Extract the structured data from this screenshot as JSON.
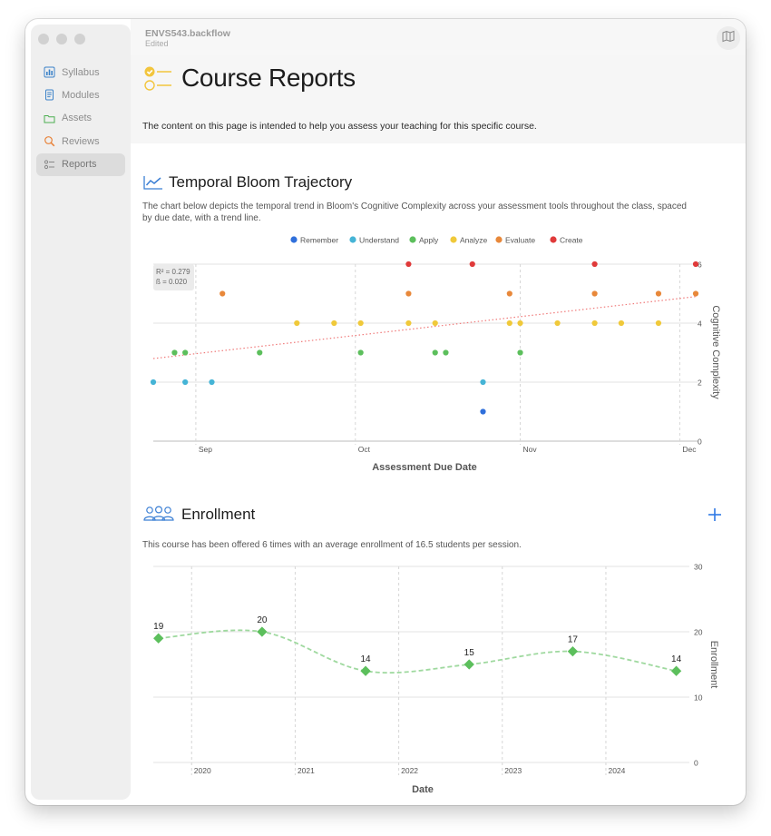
{
  "document": {
    "title": "ENVS543.backflow",
    "subtitle": "Edited"
  },
  "sidebar": {
    "items": [
      {
        "label": "Syllabus",
        "icon": "chart-bar-icon",
        "color": "#3b82c8"
      },
      {
        "label": "Modules",
        "icon": "document-icon",
        "color": "#3b82c8"
      },
      {
        "label": "Assets",
        "icon": "folder-icon",
        "color": "#4caf50"
      },
      {
        "label": "Reviews",
        "icon": "magnifier-icon",
        "color": "#e8833a"
      },
      {
        "label": "Reports",
        "icon": "checklist-icon",
        "color": "#888888"
      }
    ],
    "active_index": 4
  },
  "header": {
    "title": "Course Reports",
    "description": "The content on this page is intended to help you assess your teaching for this specific course."
  },
  "bloom": {
    "title": "Temporal Bloom Trajectory",
    "description_line1": "The chart below depicts the temporal trend in Bloom's Cognitive Complexity across your assessment tools throughout the class, spaced",
    "description_line2": "by due date, with a trend line."
  },
  "enrollment": {
    "title": "Enrollment",
    "description": "This course has been offered 6 times with an average enrollment of 16.5 students per session."
  },
  "chart_data": [
    {
      "type": "scatter",
      "legend": [
        {
          "name": "Remember",
          "color": "#2f6fdb"
        },
        {
          "name": "Understand",
          "color": "#45b4d6"
        },
        {
          "name": "Apply",
          "color": "#5cbf5c"
        },
        {
          "name": "Analyze",
          "color": "#f0c93a"
        },
        {
          "name": "Evaluate",
          "color": "#e8883a"
        },
        {
          "name": "Create",
          "color": "#e03a3a"
        }
      ],
      "legend_position": "top",
      "stats": [
        "R² = 0.279",
        "ß  = 0.020"
      ],
      "xlabel": "Assessment Due Date",
      "ylabel": "Cognitive Complexity",
      "x_ticks": [
        "Sep",
        "Oct",
        "Nov",
        "Dec"
      ],
      "x_range": [
        "2023-08-24",
        "2023-12-04"
      ],
      "ylim": [
        0,
        6
      ],
      "y_ticks": [
        0,
        2,
        4,
        6
      ],
      "trend_line": {
        "start": [
          "2023-08-24",
          2.8
        ],
        "end": [
          "2023-12-04",
          4.9
        ],
        "color": "#f07a7a",
        "style": "dotted"
      },
      "points": [
        [
          "2023-08-24",
          2,
          "Understand"
        ],
        [
          "2023-08-28",
          3,
          "Apply"
        ],
        [
          "2023-08-30",
          3,
          "Apply"
        ],
        [
          "2023-08-30",
          2,
          "Understand"
        ],
        [
          "2023-09-04",
          2,
          "Understand"
        ],
        [
          "2023-09-06",
          5,
          "Evaluate"
        ],
        [
          "2023-09-13",
          3,
          "Apply"
        ],
        [
          "2023-09-20",
          4,
          "Analyze"
        ],
        [
          "2023-09-27",
          4,
          "Analyze"
        ],
        [
          "2023-10-02",
          4,
          "Analyze"
        ],
        [
          "2023-10-02",
          3,
          "Apply"
        ],
        [
          "2023-10-11",
          6,
          "Create"
        ],
        [
          "2023-10-11",
          5,
          "Evaluate"
        ],
        [
          "2023-10-11",
          4,
          "Analyze"
        ],
        [
          "2023-10-16",
          4,
          "Analyze"
        ],
        [
          "2023-10-16",
          3,
          "Apply"
        ],
        [
          "2023-10-18",
          3,
          "Apply"
        ],
        [
          "2023-10-23",
          6,
          "Create"
        ],
        [
          "2023-10-25",
          2,
          "Understand"
        ],
        [
          "2023-10-25",
          1,
          "Remember"
        ],
        [
          "2023-10-30",
          5,
          "Evaluate"
        ],
        [
          "2023-10-30",
          4,
          "Analyze"
        ],
        [
          "2023-11-01",
          4,
          "Analyze"
        ],
        [
          "2023-11-01",
          3,
          "Apply"
        ],
        [
          "2023-11-08",
          4,
          "Analyze"
        ],
        [
          "2023-11-15",
          6,
          "Create"
        ],
        [
          "2023-11-15",
          5,
          "Evaluate"
        ],
        [
          "2023-11-15",
          4,
          "Analyze"
        ],
        [
          "2023-11-20",
          4,
          "Analyze"
        ],
        [
          "2023-11-27",
          5,
          "Evaluate"
        ],
        [
          "2023-11-27",
          4,
          "Analyze"
        ],
        [
          "2023-12-04",
          6,
          "Create"
        ],
        [
          "2023-12-04",
          5,
          "Evaluate"
        ]
      ]
    },
    {
      "type": "line",
      "xlabel": "Date",
      "ylabel": "Enrollment",
      "x_ticks": [
        "2020",
        "2021",
        "2022",
        "2023",
        "2024"
      ],
      "x_range": [
        2019.55,
        2024.7
      ],
      "ylim": [
        0,
        30
      ],
      "y_ticks": [
        0,
        10,
        20,
        30
      ],
      "series": [
        {
          "color": "#5cbf5c",
          "x": [
            2019.6,
            2020.6,
            2021.6,
            2022.6,
            2023.6,
            2024.6
          ],
          "values": [
            19,
            20,
            14,
            15,
            17,
            14
          ]
        }
      ]
    }
  ]
}
